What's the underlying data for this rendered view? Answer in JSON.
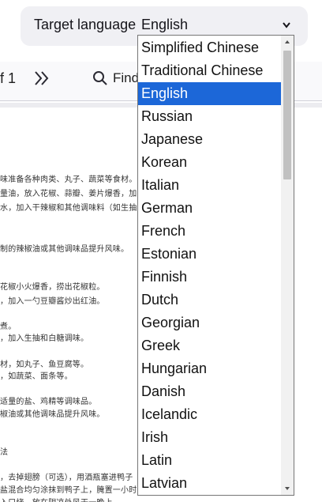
{
  "toolbar": {
    "page_of": "f 1",
    "next_icon": "double-chevron-right-icon",
    "find_label": "Find",
    "find_icon": "search-icon"
  },
  "document": {
    "lines": [
      "味准备各种肉类、丸子、蔬菜等食材。",
      "量油，放入花椒、蒜瓣、姜片爆香，加",
      "水，加入干辣椒和其他调味料（如生抽",
      "制的辣椒油或其他调味品提升风味。",
      "花椒小火爆香，捞出花椒粒。",
      "，加入一勺豆瓣酱炒出红油。",
      "煮。",
      "，加入生抽和白糖调味。",
      "材，如丸子、鱼豆腐等。",
      "，如蔬菜、面条等。",
      "适量的盐、鸡精等调味品。",
      "椒油或其他调味品提升风味。",
      "法",
      "，去掉翅膀（可选），用酒瓶塞进鸭子",
      "盐混合均匀涂抹到鸭子上，腌置一小时",
      "入口烧，放在阴凉处风干一晚上。"
    ]
  },
  "language_bar": {
    "label": "Target language",
    "selected": "English",
    "caret_icon": "chevron-down-icon"
  },
  "dropdown": {
    "options": [
      "Simplified Chinese",
      "Traditional Chinese",
      "English",
      "Russian",
      "Japanese",
      "Korean",
      "Italian",
      "German",
      "French",
      "Estonian",
      "Finnish",
      "Dutch",
      "Georgian",
      "Greek",
      "Hungarian",
      "Danish",
      "Icelandic",
      "Irish",
      "Latin",
      "Latvian"
    ],
    "selected_index": 2,
    "selected_color": "#1c67d8"
  }
}
